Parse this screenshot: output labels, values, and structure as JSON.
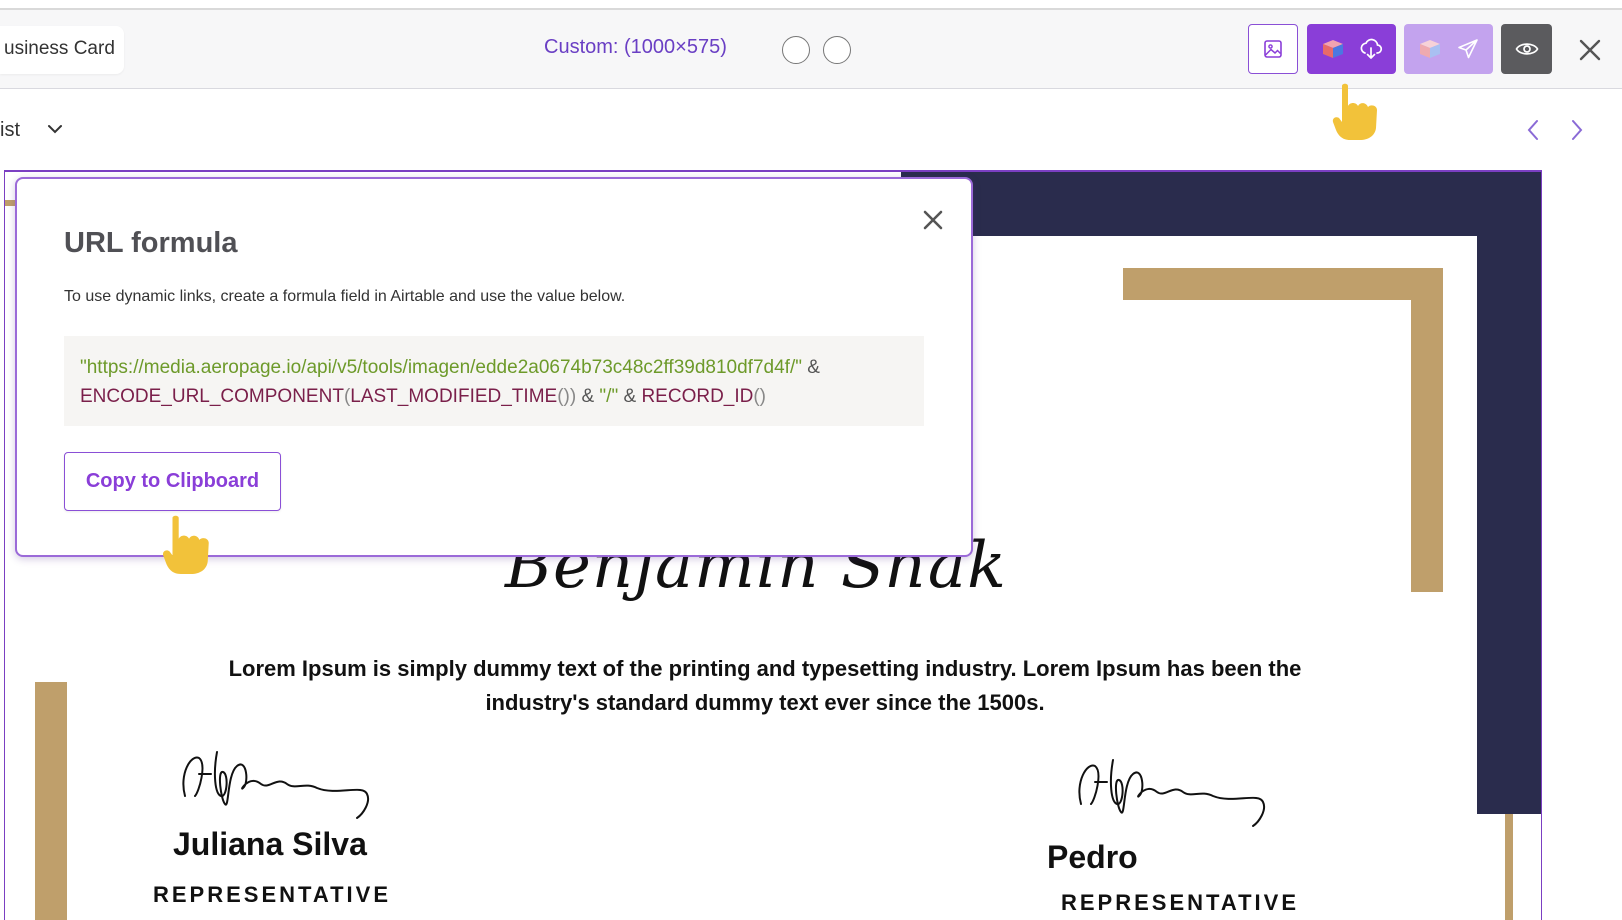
{
  "toolbar": {
    "doc_tab_label": "usiness Card",
    "size_label": "Custom: (1000×575)",
    "colors": {
      "accent": "#8a3ed8",
      "accent_light": "#c3a3ee",
      "preview_bg": "#5b5b5e"
    },
    "icons": [
      "image-icon",
      "box-icon",
      "cloud-download-icon",
      "send-icon",
      "eye-icon",
      "close-icon"
    ]
  },
  "list_selector": {
    "label": "ist"
  },
  "modal": {
    "title": "URL formula",
    "description": "To use dynamic links, create a formula field in Airtable and use the value below.",
    "formula": {
      "url_string": "\"https://media.aeropage.io/api/v5/tools/imagen/edde2a0674b73c48c2ff39d810df7d4f/\"",
      "amp1": "&",
      "encode_fn": "ENCODE_URL_COMPONENT",
      "open1": "(",
      "modified_fn": "LAST_MODIFIED_TIME",
      "close1": "())",
      "amp2": "&",
      "slash_string": "\"/\"",
      "amp3": "&",
      "record_fn": "RECORD_ID",
      "close2": "()"
    },
    "copy_button_label": "Copy to Clipboard"
  },
  "certificate": {
    "recipient_name": "Benjamin Shak",
    "body_text": "Lorem Ipsum is simply dummy text of the printing and typesetting industry. Lorem Ipsum has been the industry's standard dummy text ever since the 1500s.",
    "signer_left_name": "Juliana Silva",
    "signer_left_role": "REPRESENTATIVE",
    "signer_right_name": "Pedro",
    "signer_right_role": "REPRESENTATIVE",
    "colors": {
      "navy": "#2a2c4d",
      "gold": "#bf9f6b"
    }
  }
}
